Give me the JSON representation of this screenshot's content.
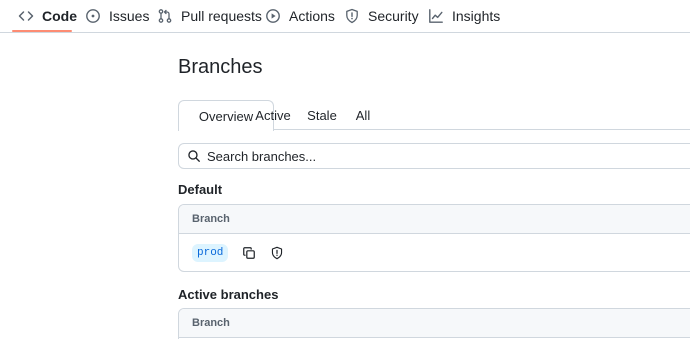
{
  "repo_nav": {
    "items": [
      {
        "label": "Code",
        "icon": "code-icon",
        "selected": true
      },
      {
        "label": "Issues",
        "icon": "issue-opened-icon",
        "selected": false
      },
      {
        "label": "Pull requests",
        "icon": "git-pull-request-icon",
        "selected": false
      },
      {
        "label": "Actions",
        "icon": "play-icon",
        "selected": false
      },
      {
        "label": "Security",
        "icon": "shield-icon",
        "selected": false
      },
      {
        "label": "Insights",
        "icon": "graph-icon",
        "selected": false
      }
    ],
    "accent_color": "#fd8c73"
  },
  "page": {
    "title": "Branches"
  },
  "tabs": [
    {
      "label": "Overview",
      "selected": true
    },
    {
      "label": "Active",
      "selected": false
    },
    {
      "label": "Stale",
      "selected": false
    },
    {
      "label": "All",
      "selected": false
    }
  ],
  "search": {
    "placeholder": "Search branches..."
  },
  "default_section": {
    "heading": "Default",
    "column_header": "Branch",
    "rows": [
      {
        "branch": "prod",
        "actions": [
          "copy-icon",
          "shield-icon"
        ]
      }
    ]
  },
  "active_section": {
    "heading": "Active branches",
    "column_header": "Branch"
  }
}
